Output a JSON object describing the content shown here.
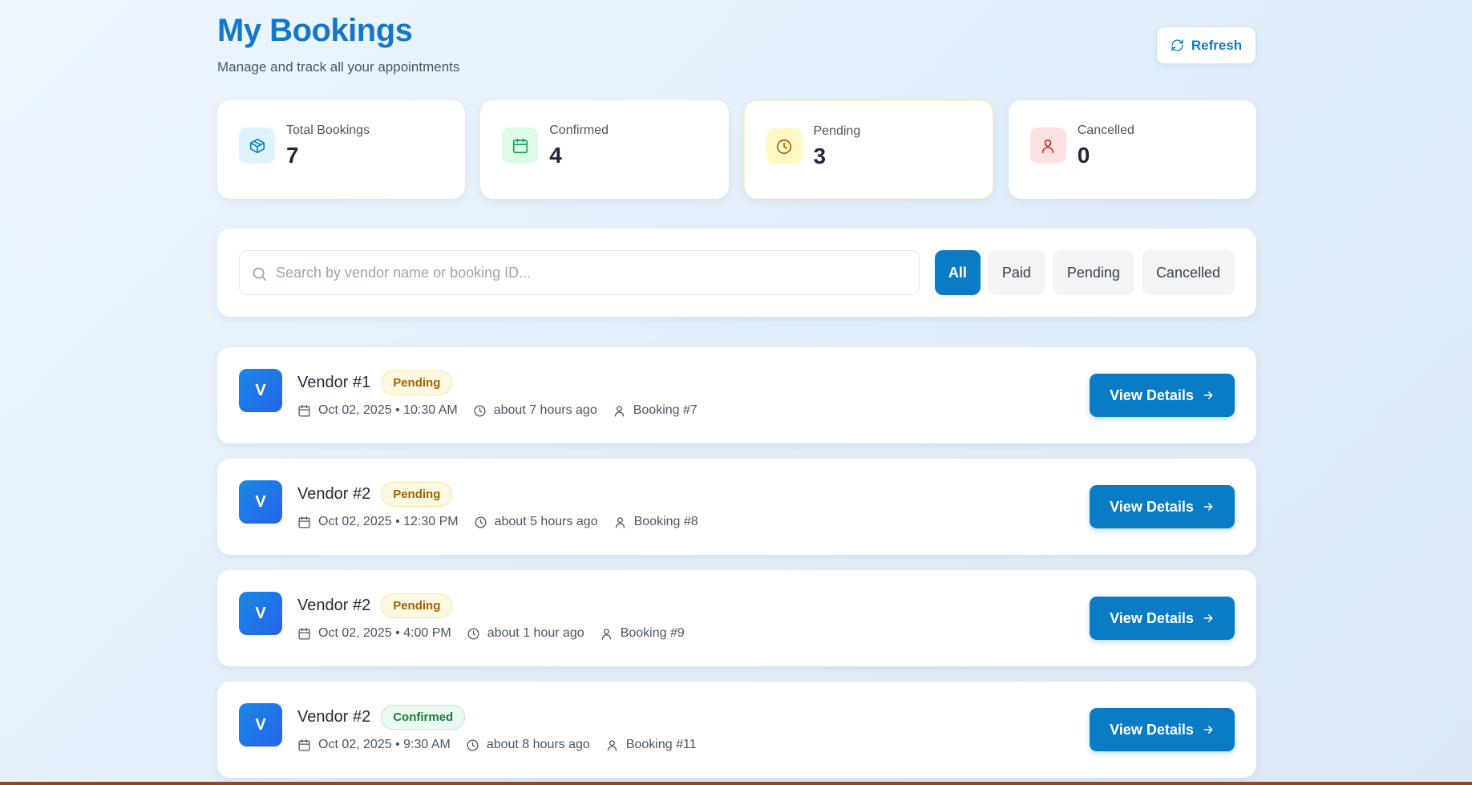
{
  "header": {
    "title": "My Bookings",
    "subtitle": "Manage and track all your appointments",
    "refresh_label": "Refresh"
  },
  "stats": [
    {
      "label": "Total Bookings",
      "value": "7",
      "icon": "box-icon",
      "color": "#0ea5e9",
      "bg": "#e0f2fe"
    },
    {
      "label": "Confirmed",
      "value": "4",
      "icon": "calendar-icon",
      "color": "#16a34a",
      "bg": "#dcfce7"
    },
    {
      "label": "Pending",
      "value": "3",
      "icon": "clock-icon",
      "color": "#ca8a04",
      "bg": "#fef9c3"
    },
    {
      "label": "Cancelled",
      "value": "0",
      "icon": "user-icon",
      "color": "#dc2626",
      "bg": "#fee2e2"
    }
  ],
  "search": {
    "placeholder": "Search by vendor name or booking ID...",
    "value": ""
  },
  "filters": [
    {
      "label": "All",
      "active": true
    },
    {
      "label": "Paid",
      "active": false
    },
    {
      "label": "Pending",
      "active": false
    },
    {
      "label": "Cancelled",
      "active": false
    }
  ],
  "bookings": [
    {
      "avatar": "V",
      "vendor": "Vendor #1",
      "status": "Pending",
      "date": "Oct 02, 2025 • 10:30 AM",
      "ago": "about 7 hours ago",
      "booking": "Booking #7",
      "action": "View Details"
    },
    {
      "avatar": "V",
      "vendor": "Vendor #2",
      "status": "Pending",
      "date": "Oct 02, 2025 • 12:30 PM",
      "ago": "about 5 hours ago",
      "booking": "Booking #8",
      "action": "View Details"
    },
    {
      "avatar": "V",
      "vendor": "Vendor #2",
      "status": "Pending",
      "date": "Oct 02, 2025 • 4:00 PM",
      "ago": "about 1 hour ago",
      "booking": "Booking #9",
      "action": "View Details"
    },
    {
      "avatar": "V",
      "vendor": "Vendor #2",
      "status": "Confirmed",
      "date": "Oct 02, 2025 • 9:30 AM",
      "ago": "about 8 hours ago",
      "booking": "Booking #11",
      "action": "View Details"
    }
  ],
  "colors": {
    "accent": "#0a7cc6",
    "title": "#1378c9",
    "pending_badge": "#a16207",
    "confirmed_badge": "#15803d"
  }
}
